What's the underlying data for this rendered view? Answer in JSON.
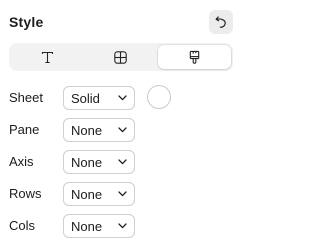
{
  "panel": {
    "title": "Style"
  },
  "tabs": [
    {
      "icon": "text-icon",
      "active": false
    },
    {
      "icon": "grid-icon",
      "active": false
    },
    {
      "icon": "brush-icon",
      "active": true
    }
  ],
  "rows": {
    "sheet": {
      "label": "Sheet",
      "value": "Solid",
      "color": "#ffffff"
    },
    "pane": {
      "label": "Pane",
      "value": "None"
    },
    "axis": {
      "label": "Axis",
      "value": "None"
    },
    "rows": {
      "label": "Rows",
      "value": "None"
    },
    "cols": {
      "label": "Cols",
      "value": "None"
    }
  }
}
